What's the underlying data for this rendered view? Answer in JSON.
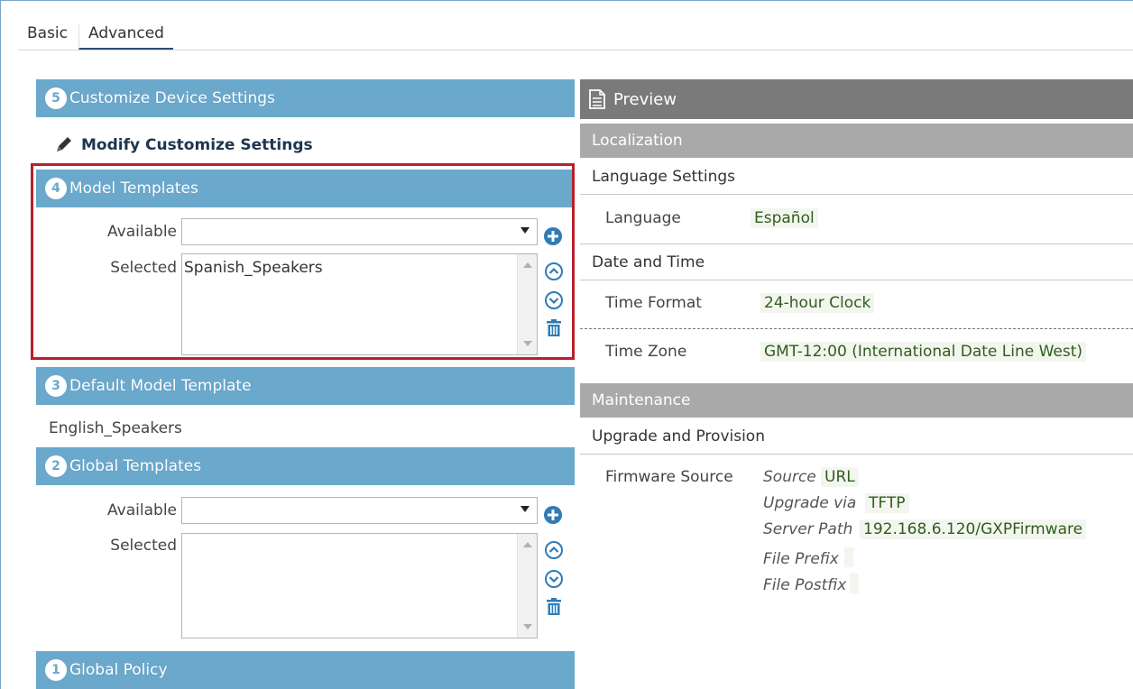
{
  "tabs": {
    "basic": "Basic",
    "advanced": "Advanced"
  },
  "sections": {
    "customize": {
      "num": "5",
      "title": "Customize Device Settings"
    },
    "model": {
      "num": "4",
      "title": "Model Templates"
    },
    "default_model": {
      "num": "3",
      "title": "Default Model Template"
    },
    "global_templates": {
      "num": "2",
      "title": "Global Templates"
    },
    "global_policy": {
      "num": "1",
      "title": "Global Policy"
    }
  },
  "modify_label": "Modify Customize Settings",
  "model_templates": {
    "available_label": "Available",
    "available_value": "",
    "selected_label": "Selected",
    "selected_items": [
      "Spanish_Speakers"
    ]
  },
  "default_model_value": "English_Speakers",
  "global_templates": {
    "available_label": "Available",
    "available_value": "",
    "selected_label": "Selected",
    "selected_items": []
  },
  "preview": {
    "title": "Preview",
    "localization": "Localization",
    "language_settings": "Language Settings",
    "language_key": "Language",
    "language_val": "Español",
    "date_time": "Date and Time",
    "time_format_key": "Time Format",
    "time_format_val": "24-hour Clock",
    "time_zone_key": "Time Zone",
    "time_zone_val": "GMT-12:00 (International Date Line West)",
    "maintenance": "Maintenance",
    "upgrade": "Upgrade and Provision",
    "firmware_key": "Firmware Source",
    "source_key": "Source",
    "source_val": "URL",
    "upgrade_via_key": "Upgrade via",
    "upgrade_via_val": "TFTP",
    "server_path_key": "Server Path",
    "server_path_val": "192.168.6.120/GXPFirmware",
    "file_prefix_key": "File Prefix",
    "file_prefix_val": "",
    "file_postfix_key": "File Postfix",
    "file_postfix_val": ""
  },
  "colors": {
    "section_header": "#6aa8cc",
    "preview_header": "#7a7a7a",
    "preview_section": "#a9a9a9",
    "highlight_border": "#b8202a",
    "icon_blue": "#2e7cb8",
    "value_text": "#2f5d1d"
  },
  "icons": {
    "pencil": "pencil-icon",
    "add": "add-circle-icon",
    "move_up": "chevron-up-circle-icon",
    "move_down": "chevron-down-circle-icon",
    "delete": "trash-icon",
    "document": "document-icon"
  }
}
